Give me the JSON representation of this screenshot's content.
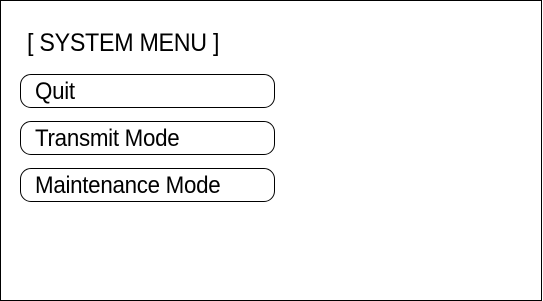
{
  "window": {
    "title": "[ SYSTEM MENU ]"
  },
  "menu": {
    "items": [
      {
        "label": "Quit"
      },
      {
        "label": "Transmit Mode"
      },
      {
        "label": "Maintenance Mode"
      }
    ]
  },
  "colors": {
    "background": "#ffffff",
    "foreground": "#000000"
  }
}
